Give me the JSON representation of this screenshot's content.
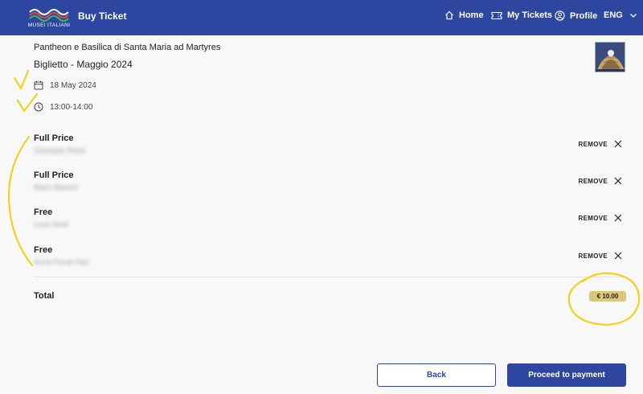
{
  "header": {
    "logo_text": "MUSEI ITALIANI",
    "title": "Buy Ticket",
    "nav": {
      "home": "Home",
      "my_tickets": "My Tickets",
      "profile": "Profile",
      "language": "ENG"
    }
  },
  "event": {
    "name": "Pantheon e Basilica di Santa Maria ad Martyres",
    "subtitle": "Biglietto - Maggio 2024",
    "date": "18 May 2024",
    "time": "13:00-14:00"
  },
  "tickets": [
    {
      "type": "Full Price",
      "holder": "Giuseppe Rossi",
      "remove_label": "REMOVE"
    },
    {
      "type": "Full Price",
      "holder": "Mario Bianchi",
      "remove_label": "REMOVE"
    },
    {
      "type": "Free",
      "holder": "Luca Verdi",
      "remove_label": "REMOVE"
    },
    {
      "type": "Free",
      "holder": "Anna Ferrari Neri",
      "remove_label": "REMOVE"
    }
  ],
  "summary": {
    "total_label": "Total",
    "total_value": "€ 10.00"
  },
  "actions": {
    "back_label": "Back",
    "proceed_label": "Proceed to payment"
  },
  "colors": {
    "header_bg": "#2d46a0",
    "accent": "#2d46a0",
    "price_badge": "#d9c87a",
    "annotation": "#f2d21e"
  }
}
